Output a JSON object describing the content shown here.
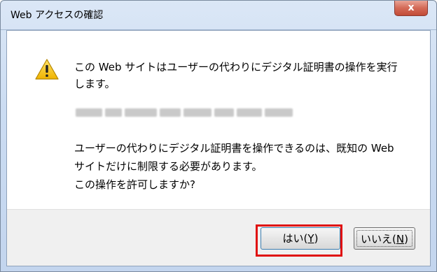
{
  "window": {
    "title": "Web アクセスの確認",
    "close_label": "x"
  },
  "message": {
    "line1": "この Web サイトはユーザーの代わりにデジタル証明書の操作を実行",
    "line2": "します。",
    "para_line1": "ユーザーの代わりにデジタル証明書を操作できるのは、既知の Web",
    "para_line2": "サイトだけに制限する必要があります。",
    "para_line3": "この操作を許可しますか?"
  },
  "icons": {
    "warning": "warning-icon"
  },
  "buttons": {
    "yes_label": "はい(",
    "yes_key": "Y",
    "yes_end": ")",
    "no_label": "いいえ(",
    "no_key": "N",
    "no_end": ")"
  },
  "colors": {
    "highlight": "#e01010",
    "warning_fill": "#f4c20d"
  }
}
